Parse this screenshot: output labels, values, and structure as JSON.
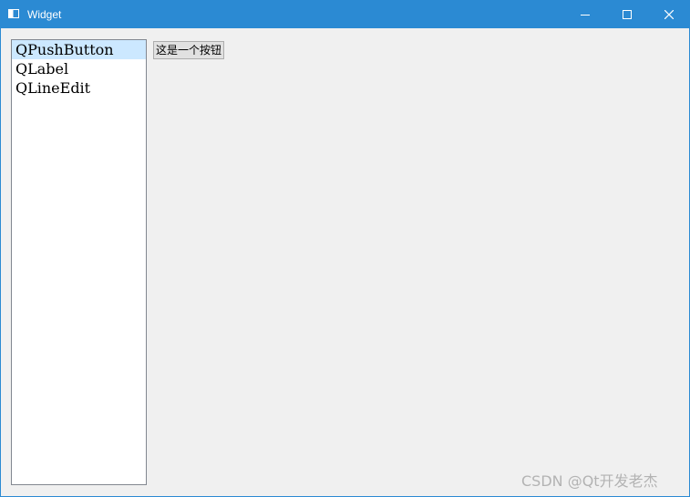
{
  "window": {
    "title": "Widget",
    "colors": {
      "titlebar": "#2b8ad3",
      "client": "#f0f0f0",
      "selection": "#cce8ff"
    },
    "controls": [
      "minimize-icon",
      "maximize-icon",
      "close-icon"
    ]
  },
  "list": {
    "items": [
      {
        "label": "QPushButton",
        "selected": true
      },
      {
        "label": "QLabel",
        "selected": false
      },
      {
        "label": "QLineEdit",
        "selected": false
      }
    ]
  },
  "content": {
    "button_label": "这是一个按钮"
  },
  "watermark": {
    "text": "CSDN @Qt开发老杰"
  }
}
